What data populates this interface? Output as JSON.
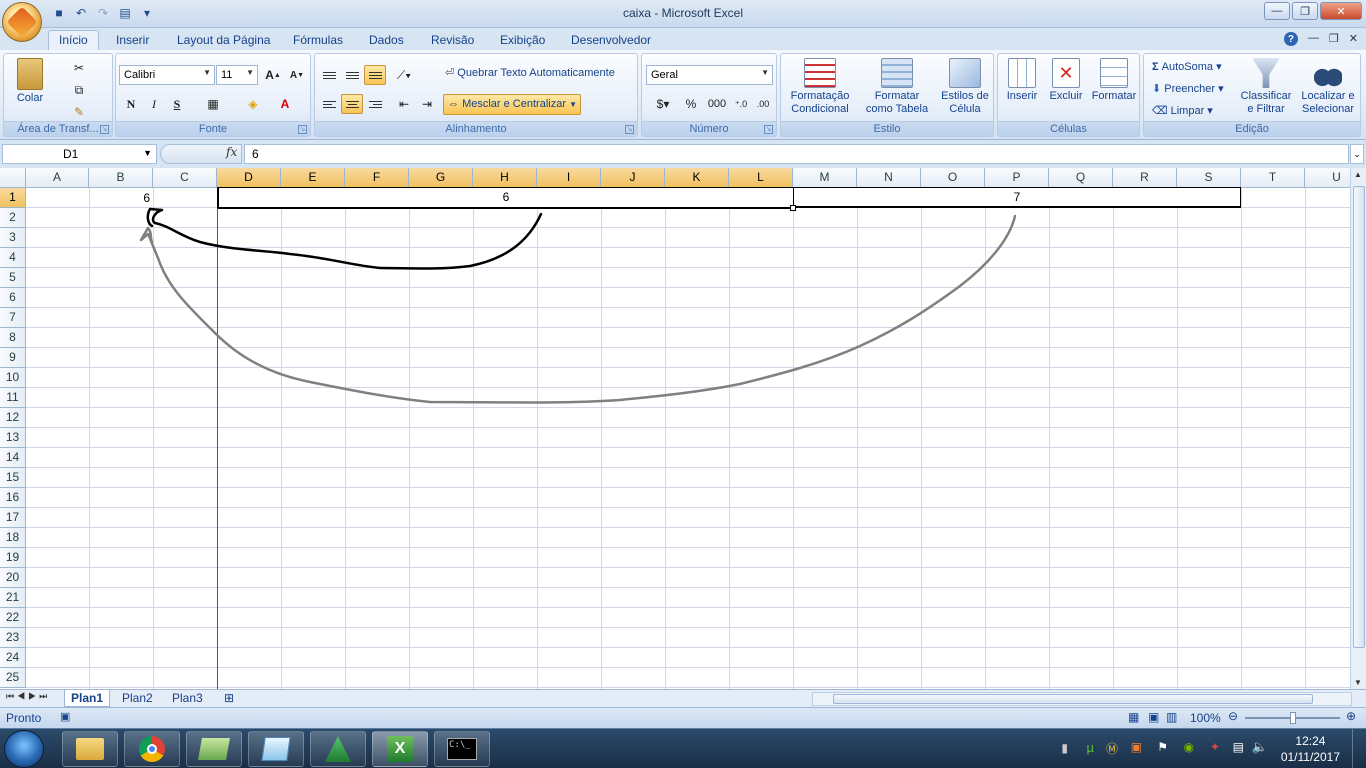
{
  "window": {
    "title": "caixa - Microsoft Excel"
  },
  "ribbon_tabs": [
    "Início",
    "Inserir",
    "Layout da Página",
    "Fórmulas",
    "Dados",
    "Revisão",
    "Exibição",
    "Desenvolvedor"
  ],
  "clipboard": {
    "paste_label": "Colar",
    "group": "Área de Transf..."
  },
  "font": {
    "name": "Calibri",
    "size": "11",
    "bold": "N",
    "italic": "I",
    "underline": "S",
    "group": "Fonte"
  },
  "alignment": {
    "wrap": "Quebrar Texto Automaticamente",
    "merge": "Mesclar e Centralizar",
    "group": "Alinhamento"
  },
  "number": {
    "format": "Geral",
    "percent": "%",
    "thousands": "000",
    "group": "Número"
  },
  "style": {
    "cond_1": "Formatação",
    "cond_2": "Condicional",
    "table_1": "Formatar",
    "table_2": "como Tabela",
    "cell_1": "Estilos de",
    "cell_2": "Célula",
    "group": "Estilo"
  },
  "cells": {
    "insert": "Inserir",
    "delete": "Excluir",
    "format": "Formatar",
    "group": "Células"
  },
  "editing": {
    "autosum": "AutoSoma",
    "fill": "Preencher",
    "clear": "Limpar",
    "sort_1": "Classificar",
    "sort_2": "e Filtrar",
    "find_1": "Localizar e",
    "find_2": "Selecionar",
    "group": "Edição"
  },
  "formula_bar": {
    "name_box": "D1",
    "fx": "fx",
    "value": "6"
  },
  "columns": [
    "A",
    "B",
    "C",
    "D",
    "E",
    "F",
    "G",
    "H",
    "I",
    "J",
    "K",
    "L",
    "M",
    "N",
    "O",
    "P",
    "Q",
    "R",
    "S",
    "T",
    "U"
  ],
  "rows": [
    "1",
    "2",
    "3",
    "4",
    "5",
    "6",
    "7",
    "8",
    "9",
    "10",
    "11",
    "12",
    "13",
    "14",
    "15",
    "16",
    "17",
    "18",
    "19",
    "20",
    "21",
    "22",
    "23",
    "24",
    "25"
  ],
  "sheet": {
    "b1": "6",
    "d1_l1_merged": "6",
    "m1_s1_merged": "7"
  },
  "sheets": [
    "Plan1",
    "Plan2",
    "Plan3"
  ],
  "status": {
    "ready": "Pronto",
    "zoom": "100%"
  },
  "taskbar": {
    "time": "12:24",
    "date": "01/11/2017"
  }
}
